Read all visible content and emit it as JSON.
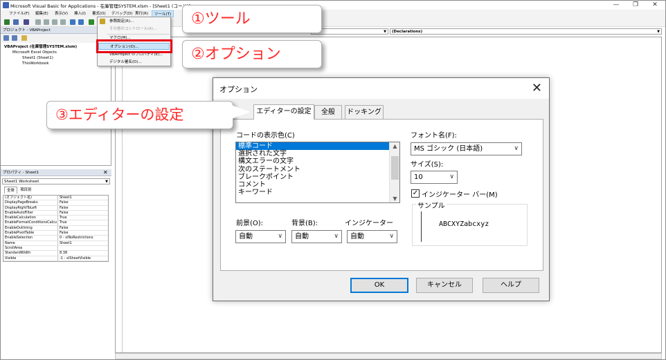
{
  "window": {
    "title": "Microsoft Visual Basic for Applications - 在庫管理SYSTEM.xlsm - [Sheet1 (コード)]",
    "controls": [
      "—",
      "❐",
      "✕"
    ]
  },
  "menubar": {
    "items": [
      "ファイル(F)",
      "編集(E)",
      "表示(V)",
      "挿入(I)",
      "書式(O)",
      "デバッグ(D)",
      "実行(R)",
      "ツール(T)"
    ]
  },
  "tools_menu": {
    "items": [
      {
        "label": "参照設定(R)...",
        "disabled": false
      },
      {
        "label": "その他のコントロール(A)...",
        "disabled": true
      },
      {
        "label": "マクロ(M)...",
        "disabled": false
      },
      {
        "label": "オプション(O)...",
        "disabled": false,
        "highlighted": true
      },
      {
        "label": "VBAProject のプロパティ(E)...",
        "disabled": false
      },
      {
        "label": "デジタル署名(D)...",
        "disabled": false
      }
    ]
  },
  "project_panel": {
    "header": "プロジェクト - VBAProject",
    "tree": [
      "VBAProject (在庫管理SYSTEM.xlsm)",
      "Microsoft Excel Objects",
      "Sheet1 (Sheet1)",
      "ThisWorkbook"
    ]
  },
  "properties_panel": {
    "header": "プロパティ - Sheet1",
    "object": "Sheet1 Worksheet",
    "tabs": [
      "全体",
      "項目別"
    ],
    "rows": [
      [
        "(オブジェクト名)",
        "Sheet1"
      ],
      [
        "DisplayPageBreaks",
        "False"
      ],
      [
        "DisplayRightToLeft",
        "False"
      ],
      [
        "EnableAutoFilter",
        "False"
      ],
      [
        "EnableCalculation",
        "True"
      ],
      [
        "EnableFormatConditionsCalcu",
        "True"
      ],
      [
        "EnableOutlining",
        "False"
      ],
      [
        "EnablePivotTable",
        "False"
      ],
      [
        "EnableSelection",
        "0 - xlNoRestrictions"
      ],
      [
        "Name",
        "Sheet1"
      ],
      [
        "ScrollArea",
        ""
      ],
      [
        "StandardWidth",
        "8.38"
      ],
      [
        "Visible",
        "-1 - xlSheetVisible"
      ]
    ]
  },
  "code_window": {
    "procedure_combo": "(Declarations)"
  },
  "callouts": {
    "step1": "①ツール",
    "step2": "②オプション",
    "step3": "③エディターの設定"
  },
  "options_dialog": {
    "title": "オプション",
    "tabs": [
      "エディターの設定",
      "全般",
      "ドッキング"
    ],
    "code_colors_label": "コードの表示色(C)",
    "code_colors_items": [
      "標準コード",
      "選択された文字",
      "構文エラーの文字",
      "次のステートメント",
      "ブレークポイント",
      "コメント",
      "キーワード"
    ],
    "foreground_label": "前景(O):",
    "background_label": "背景(B):",
    "indicator_label": "インジケーター",
    "foreground_value": "自動",
    "background_value": "自動",
    "indicator_value": "自動",
    "font_label": "フォント名(F):",
    "font_value": "MS ゴシック (日本語)",
    "size_label": "サイズ(S):",
    "size_value": "10",
    "indicator_bar_label": "インジケーター バー(M)",
    "indicator_bar_checked": true,
    "sample_label": "サンプル",
    "sample_text": "ABCXYZabcxyz",
    "buttons": {
      "ok": "OK",
      "cancel": "キャンセル",
      "help": "ヘルプ"
    }
  }
}
